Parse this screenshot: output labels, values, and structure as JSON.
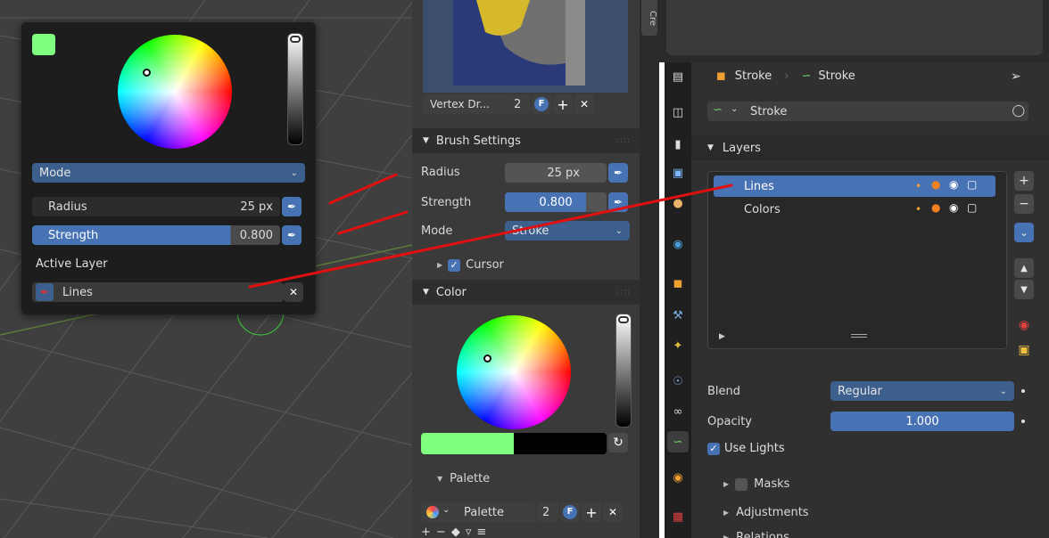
{
  "popup": {
    "swatch_color": "#80ff80",
    "mode_label": "Mode",
    "radius_label": "Radius",
    "radius_value": "25 px",
    "strength_label": "Strength",
    "strength_value": "0.800",
    "active_layer_label": "Active Layer",
    "layer_value": "Lines",
    "brightness_fraction": 1.0
  },
  "toolpanel": {
    "brush_name": "Vertex Dr...",
    "brush_users": "2",
    "brush_settings_header": "Brush Settings",
    "radius_label": "Radius",
    "radius_value": "25 px",
    "strength_label": "Strength",
    "strength_value": "0.800",
    "mode_label": "Mode",
    "mode_value": "Stroke",
    "cursor_label": "Cursor",
    "color_header": "Color",
    "palette_header": "Palette",
    "palette_name": "Palette",
    "palette_users": "2",
    "strength_fraction": 0.8
  },
  "strip": {
    "tab_label": "Cre"
  },
  "properties": {
    "breadcrumb_object": "Stroke",
    "breadcrumb_data": "Stroke",
    "datablock_name": "Stroke",
    "layers_header": "Layers",
    "layers": [
      {
        "name": "Lines",
        "selected": true
      },
      {
        "name": "Colors",
        "selected": false
      }
    ],
    "blend_label": "Blend",
    "blend_value": "Regular",
    "opacity_label": "Opacity",
    "opacity_value": "1.000",
    "use_lights_label": "Use Lights",
    "masks_label": "Masks",
    "adjustments_label": "Adjustments",
    "relations_label": "Relations"
  },
  "colors": {
    "accent_blue": "#4772b3",
    "active_color": "#80ff80",
    "annotation_red": "#e01010"
  }
}
